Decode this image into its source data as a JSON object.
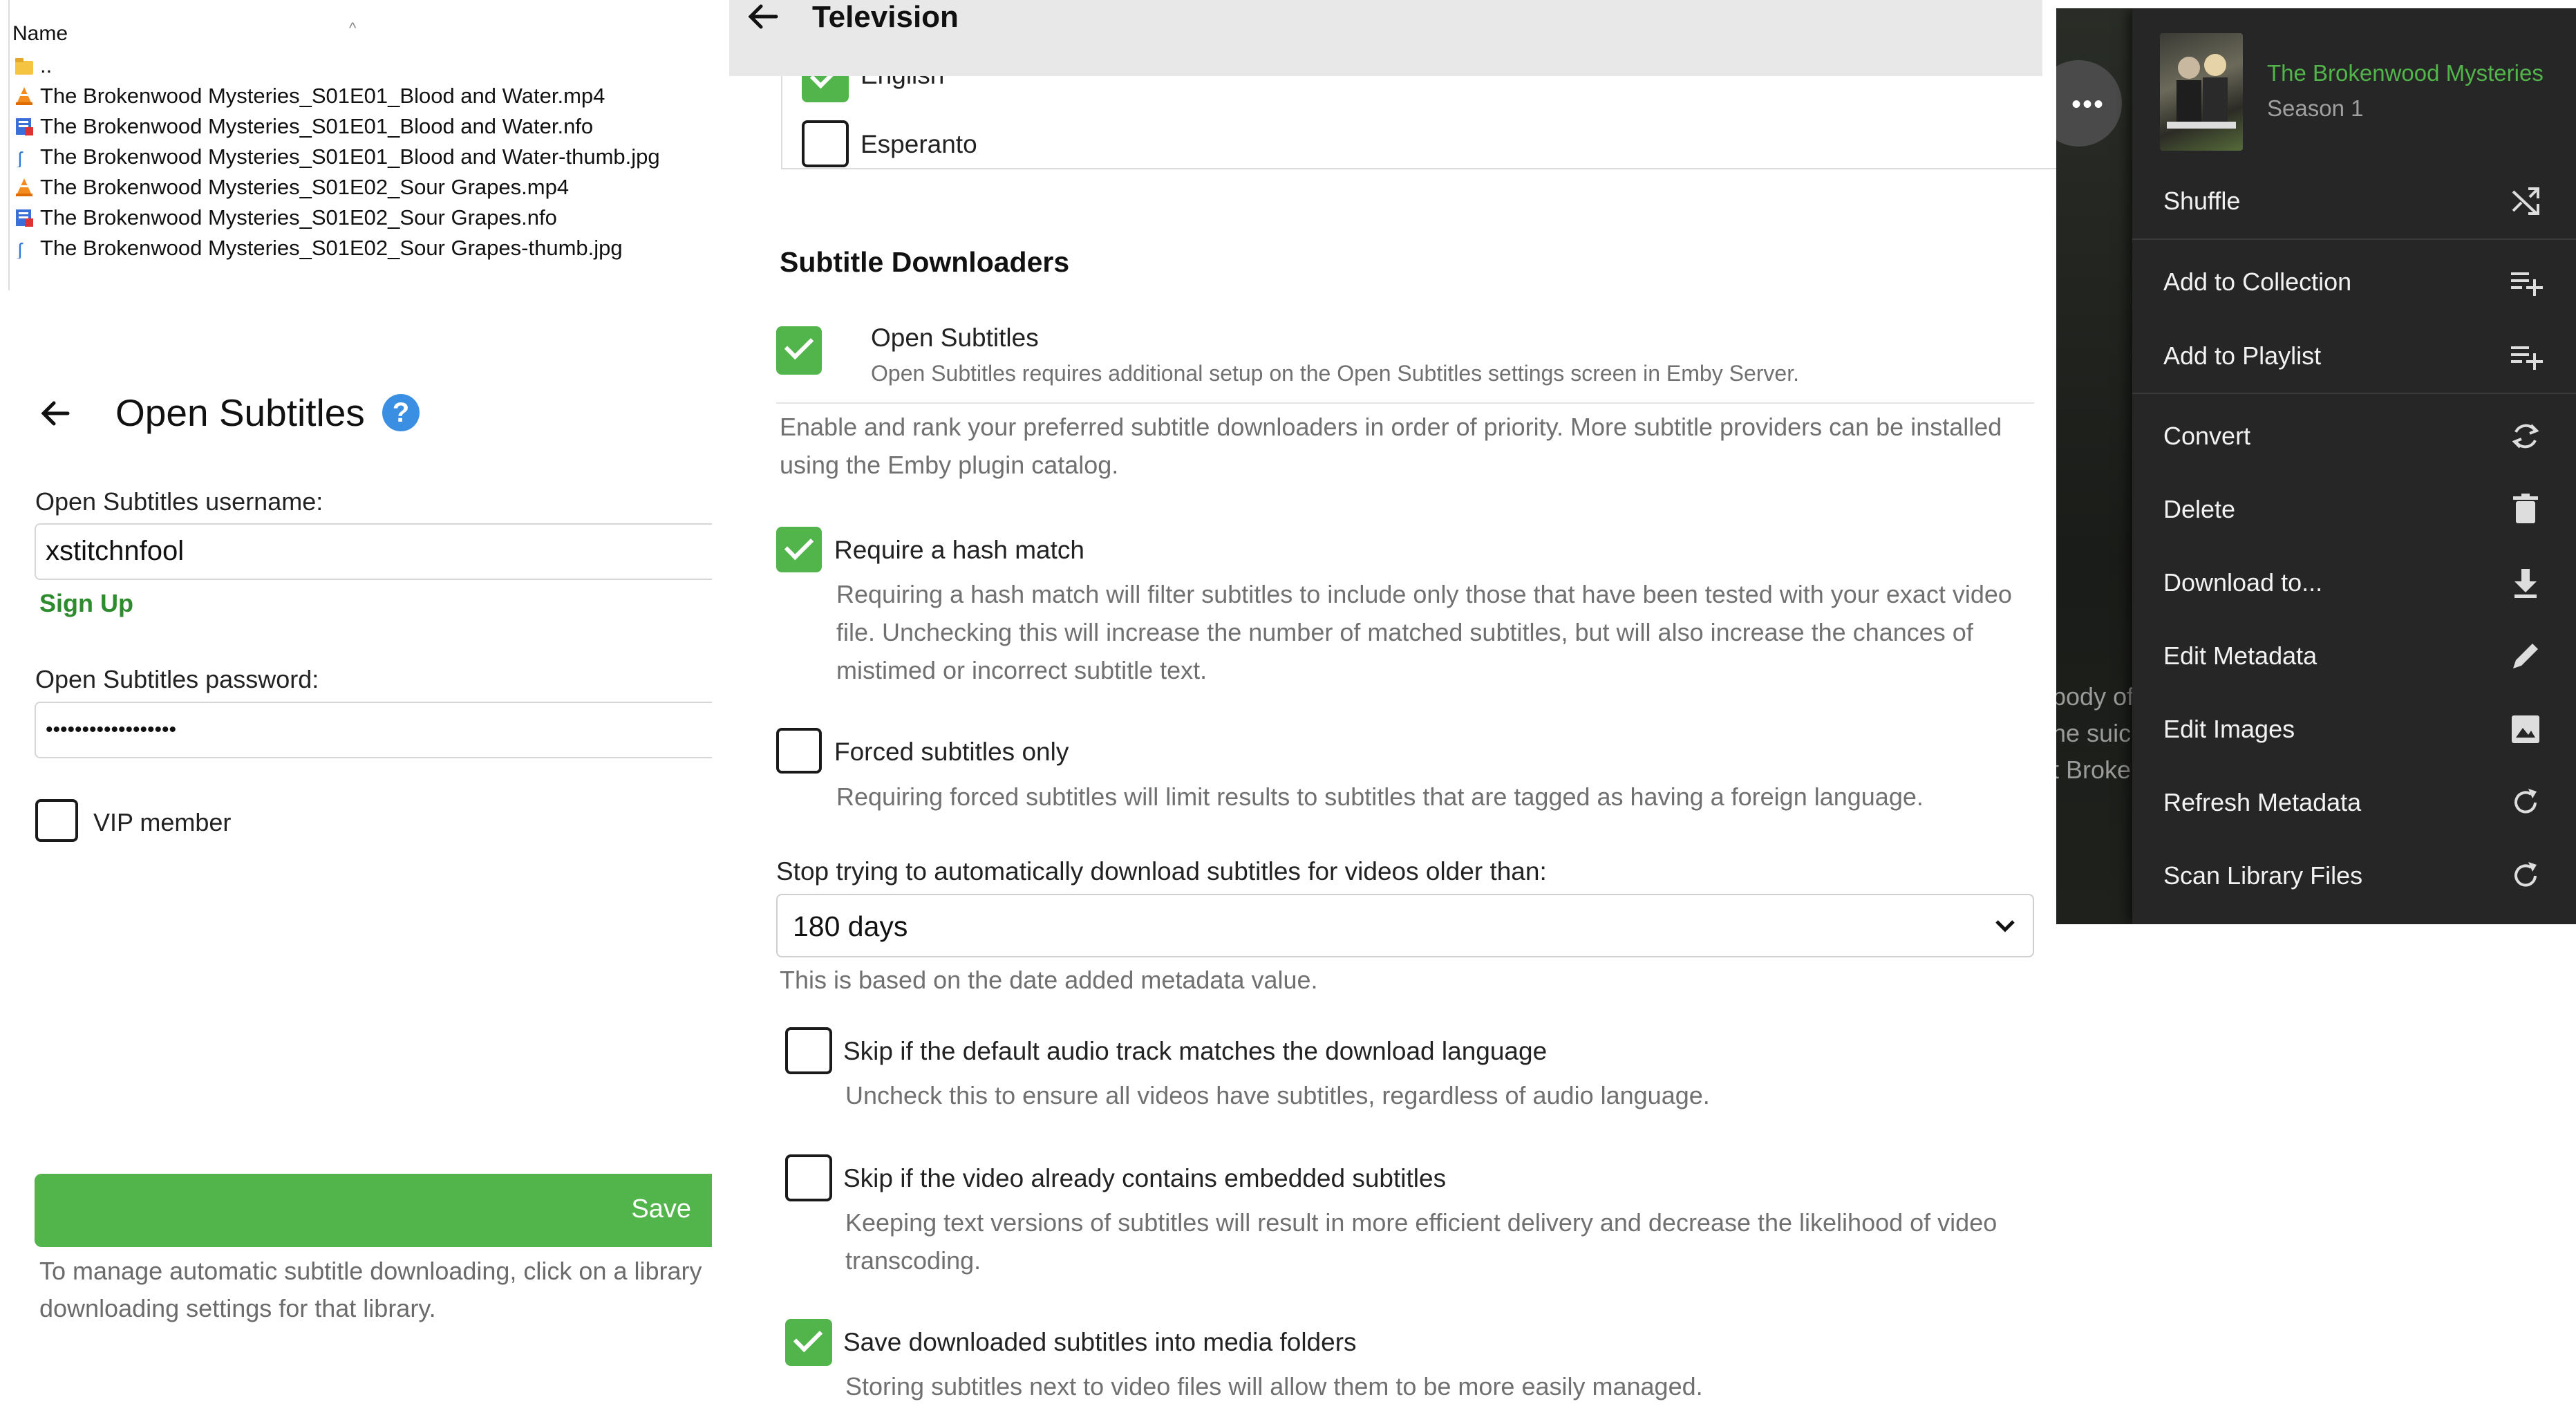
{
  "explorer": {
    "column_header": "Name",
    "sort_indicator": "^",
    "rows": [
      {
        "name": "..",
        "icon": "folder-up-icon"
      },
      {
        "name": "The Brokenwood Mysteries_S01E01_Blood and Water.mp4",
        "icon": "vlc-cone-icon"
      },
      {
        "name": "The Brokenwood Mysteries_S01E01_Blood and Water.nfo",
        "icon": "nfo-file-icon"
      },
      {
        "name": "The Brokenwood Mysteries_S01E01_Blood and Water-thumb.jpg",
        "icon": "image-file-icon"
      },
      {
        "name": "The Brokenwood Mysteries_S01E02_Sour Grapes.mp4",
        "icon": "vlc-cone-icon"
      },
      {
        "name": "The Brokenwood Mysteries_S01E02_Sour Grapes.nfo",
        "icon": "nfo-file-icon"
      },
      {
        "name": "The Brokenwood Mysteries_S01E02_Sour Grapes-thumb.jpg",
        "icon": "image-file-icon"
      }
    ]
  },
  "open_subtitles": {
    "title": "Open Subtitles",
    "username_label": "Open Subtitles username:",
    "username_value": "xstitchnfool",
    "signup_link": "Sign Up",
    "password_label": "Open Subtitles password:",
    "password_value": "••••••••••••••••••",
    "vip_label": "VIP member",
    "vip_checked": false,
    "save_label": "Save",
    "footnote_line1": "To manage automatic subtitle downloading, click on a library",
    "footnote_line2": "downloading settings for that library."
  },
  "television": {
    "title": "Television",
    "languages": [
      {
        "label": "English",
        "checked": true
      },
      {
        "label": "Esperanto",
        "checked": false
      }
    ],
    "downloaders_heading": "Subtitle Downloaders",
    "downloader": {
      "name": "Open Subtitles",
      "note": "Open Subtitles requires additional setup on the Open Subtitles settings screen in Emby Server.",
      "checked": true
    },
    "downloaders_desc_line1": "Enable and rank your preferred subtitle downloaders in order of priority. More subtitle providers can be installed",
    "downloaders_desc_line2": "using the Emby plugin catalog.",
    "hash_match": {
      "label": "Require a hash match",
      "checked": true,
      "desc_line1": "Requiring a hash match will filter subtitles to include only those that have been tested with your exact video",
      "desc_line2": "file. Unchecking this will increase the number of matched subtitles, but will also increase the chances of",
      "desc_line3": "mistimed or incorrect subtitle text."
    },
    "forced_only": {
      "label": "Forced subtitles only",
      "checked": false,
      "desc": "Requiring forced subtitles will limit results to subtitles that are tagged as having a foreign language."
    },
    "stop_label": "Stop trying to automatically download subtitles for videos older than:",
    "stop_value": "180 days",
    "stop_desc": "This is based on the date added metadata value.",
    "skip_audio": {
      "label": "Skip if the default audio track matches the download language",
      "checked": false,
      "desc": "Uncheck this to ensure all videos have subtitles, regardless of audio language."
    },
    "skip_embedded": {
      "label": "Skip if the video already contains embedded subtitles",
      "checked": false,
      "desc_line1": "Keeping text versions of subtitles will result in more efficient delivery and decrease the likelihood of video",
      "desc_line2": "transcoding."
    },
    "save_media": {
      "label": "Save downloaded subtitles into media folders",
      "checked": true,
      "desc": "Storing subtitles next to video files will allow them to be more easily managed."
    }
  },
  "context_menu": {
    "series_title": "The Brokenwood Mysteries",
    "season": "Season 1",
    "background_text": [
      "body of",
      "he suic",
      "t Broke"
    ],
    "accent_color": "#52b54b",
    "items": [
      {
        "label": "Shuffle",
        "icon": "shuffle-icon"
      },
      {
        "label": "Add to Collection",
        "icon": "playlist-add-icon"
      },
      {
        "label": "Add to Playlist",
        "icon": "playlist-add-icon"
      },
      {
        "label": "Convert",
        "icon": "sync-icon"
      },
      {
        "label": "Delete",
        "icon": "trash-icon"
      },
      {
        "label": "Download to...",
        "icon": "download-icon"
      },
      {
        "label": "Edit Metadata",
        "icon": "pencil-icon"
      },
      {
        "label": "Edit Images",
        "icon": "image-icon"
      },
      {
        "label": "Refresh Metadata",
        "icon": "refresh-icon"
      },
      {
        "label": "Scan Library Files",
        "icon": "refresh-icon"
      }
    ]
  }
}
